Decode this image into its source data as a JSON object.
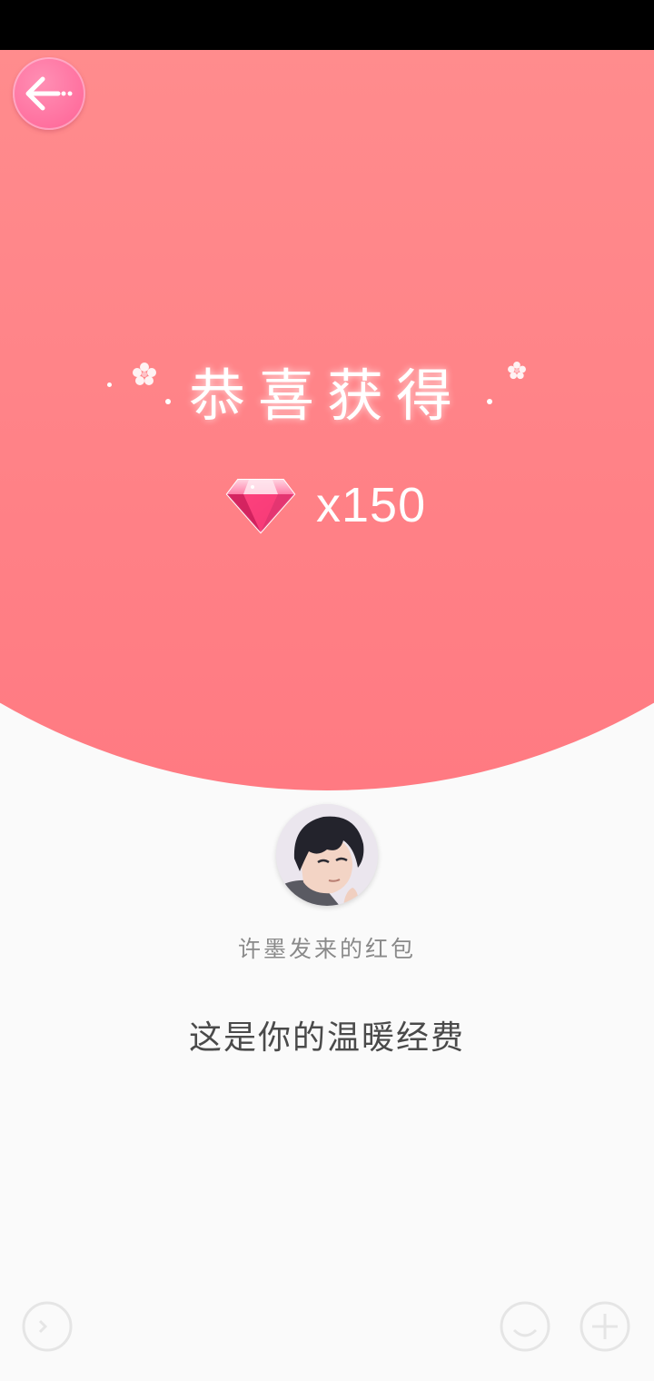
{
  "header": {
    "back_icon": "back-arrow-icon"
  },
  "reward": {
    "title": "恭喜获得",
    "item_icon": "pink-diamond-icon",
    "count_text": "x150"
  },
  "sender": {
    "avatar_icon": "character-avatar",
    "label": "许墨发来的红包"
  },
  "message": {
    "text": "这是你的温暖经费"
  },
  "colors": {
    "accent_pink": "#ff8a8c",
    "back_button": "#ff6f9e",
    "background": "#fafafa"
  }
}
